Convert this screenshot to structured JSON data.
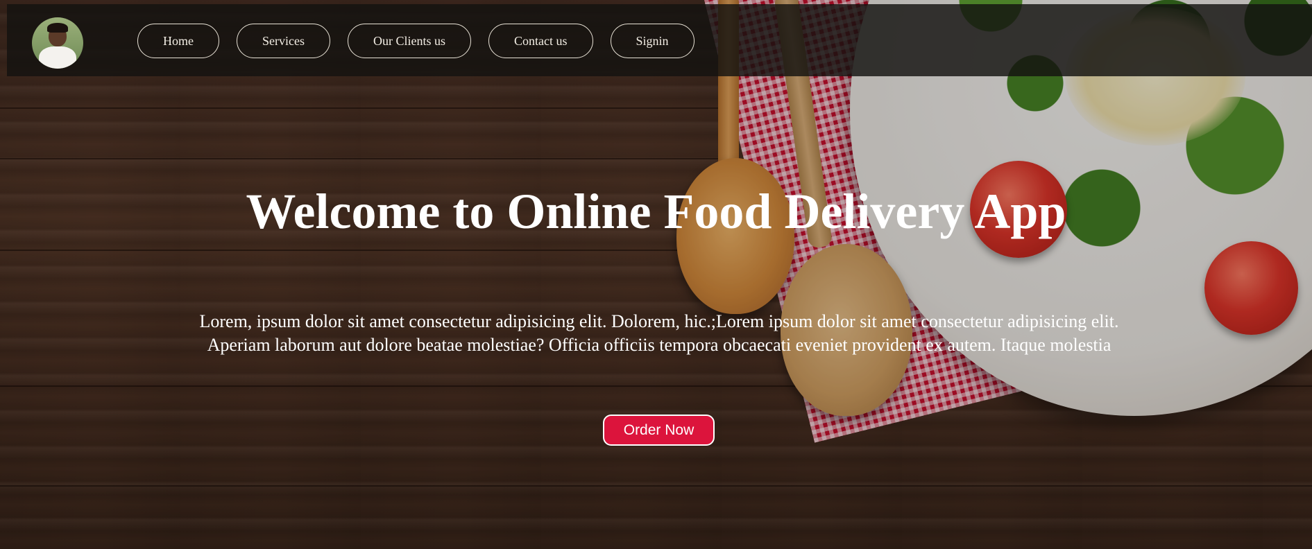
{
  "navbar": {
    "avatar_label": "profile photo",
    "links": [
      {
        "label": "Home"
      },
      {
        "label": "Services"
      },
      {
        "label": "Our Clients us"
      },
      {
        "label": "Contact us"
      },
      {
        "label": "Signin"
      }
    ]
  },
  "hero": {
    "title": "Welcome to Online Food Delivery App",
    "description": "Lorem, ipsum dolor sit amet consectetur adipisicing elit. Dolorem, hic.;Lorem ipsum dolor sit amet consectetur adipisicing elit. Aperiam laborum aut dolore beatae molestiae? Officia officiis tempora obcaecati eveniet provident ex autem. Itaque molestia",
    "cta_label": "Order Now"
  },
  "colors": {
    "accent": "#dc143c",
    "navbar_bg": "#141210",
    "text": "#ffffff"
  }
}
